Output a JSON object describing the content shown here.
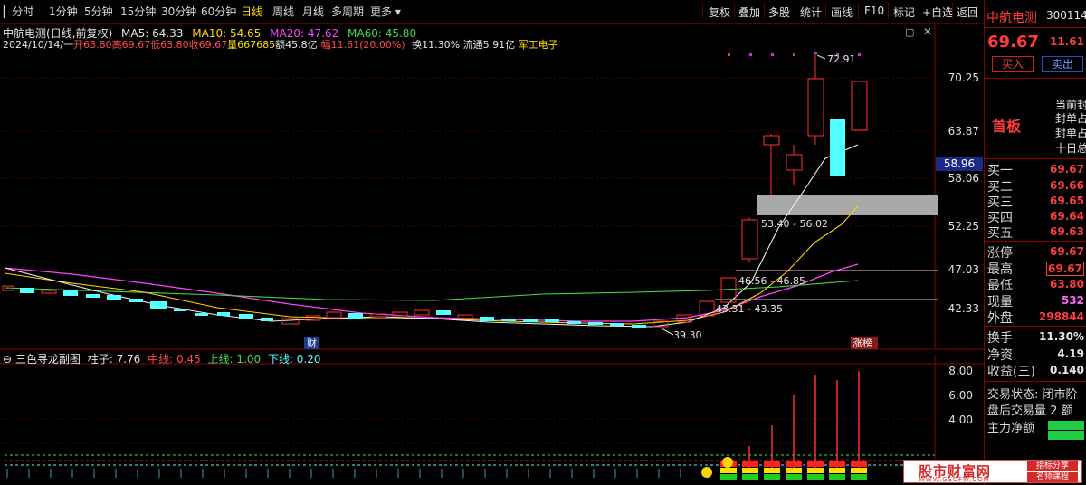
{
  "toolbar": {
    "timeframes": [
      "分时",
      "1分钟",
      "5分钟",
      "15分钟",
      "30分钟",
      "60分钟",
      "日线",
      "周线",
      "月线",
      "多周期",
      "更多"
    ],
    "active_timeframe": "日线",
    "right_buttons": [
      "复权",
      "叠加",
      "多股",
      "统计",
      "画线",
      "F10",
      "标记",
      "+自选",
      "返回"
    ]
  },
  "chart": {
    "name": "中航电测",
    "mode": "(日线,前复权)",
    "ma5_label": "MA5: 64.33",
    "ma10_label": "MA10: 54.65",
    "ma20_label": "MA20: 47.62",
    "ma60_label": "MA60: 45.80",
    "date": "2024/10/14/一",
    "open": "开63.80",
    "high": "高69.67",
    "low": "低63.80",
    "close": "收69.67",
    "volume": "量667685",
    "amount": "额45.8亿",
    "range": "幅11.61(20.00%)",
    "turnover": "换11.30%",
    "float": "流通5.91亿",
    "sector": "军工电子",
    "price_ticks": [
      "70.25",
      "63.87",
      "58.06",
      "52.25",
      "47.03",
      "42.33"
    ],
    "current_price_tag": "58.96",
    "annotations": {
      "high_mark": "72.91",
      "low_mark": "39.30",
      "zone1": "53.40 - 56.02",
      "zone2": "46.56 - 46.85",
      "zone3": "43.31 - 43.35",
      "cai": "财",
      "zhangbang": "涨榜"
    },
    "colors": {
      "up": "#ff3030",
      "down": "#54ffff",
      "ma5": "#f0f0f0",
      "ma10": "#ffd800",
      "ma20": "#ff44ff",
      "ma60": "#44dd44"
    }
  },
  "sub_chart": {
    "title": "三色寻龙副图",
    "zhuzi": "柱子: 7.76",
    "zhong": "中线: 0.45",
    "shang": "上线: 1.00",
    "xia": "下线: 0.20",
    "ticks": [
      "8.00",
      "6.00",
      "4.00"
    ]
  },
  "quote_panel": {
    "name": "中航电测",
    "code": "300114",
    "price": "69.67",
    "change": "11.61",
    "change_pct": "20",
    "buy_label": "买入",
    "sell_label": "卖出",
    "limit_label": "首板",
    "notes": [
      "当前封",
      "封单占",
      "封单占",
      "十日总"
    ],
    "bids": [
      {
        "label": "买一",
        "value": "69.67"
      },
      {
        "label": "买二",
        "value": "69.66"
      },
      {
        "label": "买三",
        "value": "69.65"
      },
      {
        "label": "买四",
        "value": "69.64"
      },
      {
        "label": "买五",
        "value": "69.63"
      }
    ],
    "stats": [
      {
        "label": "涨停",
        "value": "69.67"
      },
      {
        "label": "最高",
        "value": "69.67"
      },
      {
        "label": "最低",
        "value": "63.80"
      },
      {
        "label": "现量",
        "value": "532"
      },
      {
        "label": "外盘",
        "value": "298844"
      }
    ],
    "extra": [
      {
        "label": "换手",
        "value": "11.30%"
      },
      {
        "label": "净资",
        "value": "4.19"
      },
      {
        "label": "收益(三)",
        "value": "0.140"
      }
    ],
    "trade_state": "交易状态: 闭市阶",
    "after_hours": "盘后交易量 2 额",
    "main_flow": "主力净额"
  },
  "watermark": {
    "site": "股市财富网",
    "tag1": "指标分享",
    "tag2": "名师课程",
    "url": "WWW.GSCFW.COM"
  }
}
